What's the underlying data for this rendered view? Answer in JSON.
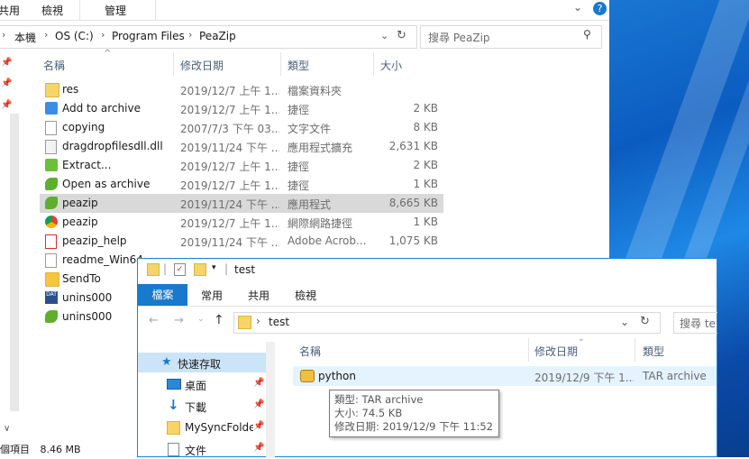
{
  "back_window": {
    "ribbon": {
      "tab_share_partial": "共用",
      "tab_view": "檢視",
      "tab_manage": "管理"
    },
    "address": {
      "crumbs": [
        "本機",
        "OS (C:)",
        "Program Files",
        "PeaZip"
      ]
    },
    "search": {
      "placeholder": "搜尋 PeaZip"
    },
    "columns": {
      "name": "名稱",
      "date": "修改日期",
      "type": "類型",
      "size": "大小"
    },
    "files": [
      {
        "name": "res",
        "date": "2019/12/7 上午 1...",
        "type": "檔案資料夾",
        "size": "",
        "icon": "folder-icon"
      },
      {
        "name": "Add to archive",
        "date": "2019/12/7 上午 1...",
        "type": "捷徑",
        "size": "2 KB",
        "icon": "shortcut-add-icon"
      },
      {
        "name": "copying",
        "date": "2007/7/3 下午 03...",
        "type": "文字文件",
        "size": "8 KB",
        "icon": "text-file-icon"
      },
      {
        "name": "dragdropfilesdll.dll",
        "date": "2019/11/24 下午 ...",
        "type": "應用程式擴充",
        "size": "2,631 KB",
        "icon": "dll-file-icon"
      },
      {
        "name": "Extract...",
        "date": "2019/12/7 上午 1...",
        "type": "捷徑",
        "size": "2 KB",
        "icon": "shortcut-extract-icon"
      },
      {
        "name": "Open as archive",
        "date": "2019/12/7 上午 1...",
        "type": "捷徑",
        "size": "1 KB",
        "icon": "shortcut-peazip-icon"
      },
      {
        "name": "peazip",
        "date": "2019/11/24 下午 ...",
        "type": "應用程式",
        "size": "8,665 KB",
        "icon": "peazip-app-icon",
        "selected": true
      },
      {
        "name": "peazip",
        "date": "2019/12/7 上午 1...",
        "type": "網際網路捷徑",
        "size": "1 KB",
        "icon": "chrome-shortcut-icon"
      },
      {
        "name": "peazip_help",
        "date": "2019/11/24 下午 ...",
        "type": "Adobe Acrob...",
        "size": "1,075 KB",
        "icon": "pdf-file-icon"
      },
      {
        "name": "readme_Win64",
        "date": "",
        "type": "",
        "size": "",
        "icon": "text-file-icon"
      },
      {
        "name": "SendTo",
        "date": "",
        "type": "",
        "size": "",
        "icon": "sendto-icon"
      },
      {
        "name": "unins000",
        "date": "",
        "type": "",
        "size": "",
        "icon": "dat-file-icon"
      },
      {
        "name": "unins000",
        "date": "",
        "type": "",
        "size": "",
        "icon": "peazip-app-icon"
      }
    ],
    "status_left": "個項目",
    "status_size": "8.46 MB"
  },
  "front_window": {
    "title": "test",
    "tabs": {
      "file": "檔案",
      "home": "常用",
      "share": "共用",
      "view": "檢視"
    },
    "address": {
      "crumb": "test"
    },
    "search": {
      "placeholder": "搜尋 te"
    },
    "nav": [
      {
        "label": "快速存取",
        "icon": "star-icon"
      },
      {
        "label": "桌面",
        "icon": "desktop-icon"
      },
      {
        "label": "下載",
        "icon": "download-icon"
      },
      {
        "label": "MySyncFolde",
        "icon": "folder-icon"
      },
      {
        "label": "文件",
        "icon": "documents-icon"
      }
    ],
    "columns": {
      "name": "名稱",
      "date": "修改日期",
      "type": "類型"
    },
    "file": {
      "name": "python",
      "date": "2019/12/9 下午 1...",
      "type": "TAR archive"
    },
    "tooltip": {
      "type_line": "類型: TAR archive",
      "size_line": "大小: 74.5 KB",
      "date_line": "修改日期: 2019/12/9 下午 11:52"
    }
  },
  "colors": {
    "accent": "#1979ca",
    "selection": "#d9d9d9",
    "hover": "#e5f3ff",
    "folder": "#f7d46a"
  }
}
